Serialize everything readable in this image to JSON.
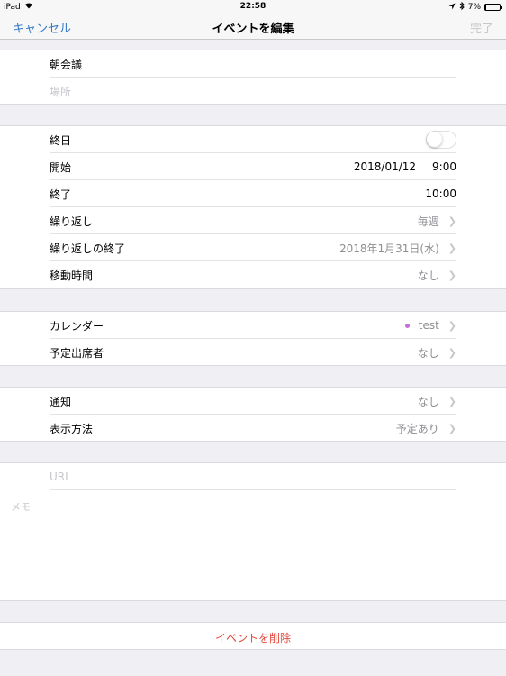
{
  "status": {
    "device": "iPad",
    "time": "22:58",
    "battery": "7%"
  },
  "nav": {
    "cancel": "キャンセル",
    "title": "イベントを編集",
    "done": "完了"
  },
  "event": {
    "title": "朝会議",
    "location_placeholder": "場所"
  },
  "schedule": {
    "all_day_label": "終日",
    "all_day_on": false,
    "start_label": "開始",
    "start_date": "2018/01/12",
    "start_time": "9:00",
    "end_label": "終了",
    "end_time": "10:00",
    "repeat_label": "繰り返し",
    "repeat_value": "毎週",
    "repeat_end_label": "繰り返しの終了",
    "repeat_end_value": "2018年1月31日(水)",
    "travel_label": "移動時間",
    "travel_value": "なし"
  },
  "calendar": {
    "calendar_label": "カレンダー",
    "calendar_value": "test",
    "calendar_color": "#c86dd7",
    "invitees_label": "予定出席者",
    "invitees_value": "なし"
  },
  "alerts": {
    "alert_label": "通知",
    "alert_value": "なし",
    "show_as_label": "表示方法",
    "show_as_value": "予定あり"
  },
  "notes": {
    "url_placeholder": "URL",
    "memo_placeholder": "メモ"
  },
  "actions": {
    "delete": "イベントを削除"
  }
}
